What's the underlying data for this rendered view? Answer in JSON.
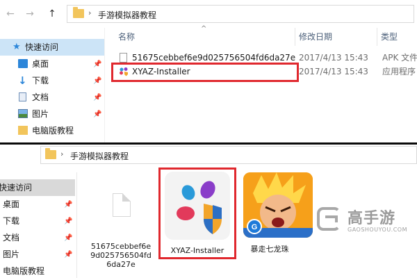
{
  "top_window": {
    "nav_back": "←",
    "nav_forward": "→",
    "nav_up": "↑",
    "path_sep": "›",
    "path": "手游模拟器教程",
    "sidebar": [
      {
        "label": "快速访问",
        "icon": "star-icon",
        "selected": true
      },
      {
        "label": "桌面",
        "icon": "desktop-icon",
        "pinned": true
      },
      {
        "label": "下载",
        "icon": "download-icon",
        "pinned": true
      },
      {
        "label": "文档",
        "icon": "documents-icon",
        "pinned": true
      },
      {
        "label": "图片",
        "icon": "pictures-icon",
        "pinned": true
      },
      {
        "label": "电脑版教程",
        "icon": "folder-icon"
      }
    ],
    "columns": {
      "name": "名称",
      "date": "修改日期",
      "type": "类型"
    },
    "files": [
      {
        "name": "51675cebbef6e9d025756504fd6da27e",
        "date": "2017/4/13 15:43",
        "type": "APK 文件"
      },
      {
        "name": "XYAZ-Installer",
        "date": "2017/4/13 15:43",
        "type": "应用程序"
      }
    ]
  },
  "bottom_window": {
    "path_sep": "›",
    "path": "手游模拟器教程",
    "sidebar": [
      {
        "label": "快速访问",
        "selected": true
      },
      {
        "label": "桌面",
        "pinned": true
      },
      {
        "label": "下载",
        "pinned": true
      },
      {
        "label": "文档",
        "pinned": true
      },
      {
        "label": "图片",
        "pinned": true
      },
      {
        "label": "电脑版教程"
      }
    ],
    "tiles": [
      {
        "label_lines": [
          "51675cebbef6e",
          "9d025756504fd",
          "6da27e"
        ]
      },
      {
        "label": "XYAZ-Installer"
      },
      {
        "label": "暴走七龙珠"
      }
    ]
  },
  "watermark": {
    "brand": "高手游",
    "domain": "GAOSHOUYOU.COM"
  },
  "colors": {
    "highlight_red": "#e0282e",
    "selected_bg": "#cce4f7",
    "folder_yellow": "#f2c55c",
    "watermark_gray": "#9a9a9a"
  }
}
